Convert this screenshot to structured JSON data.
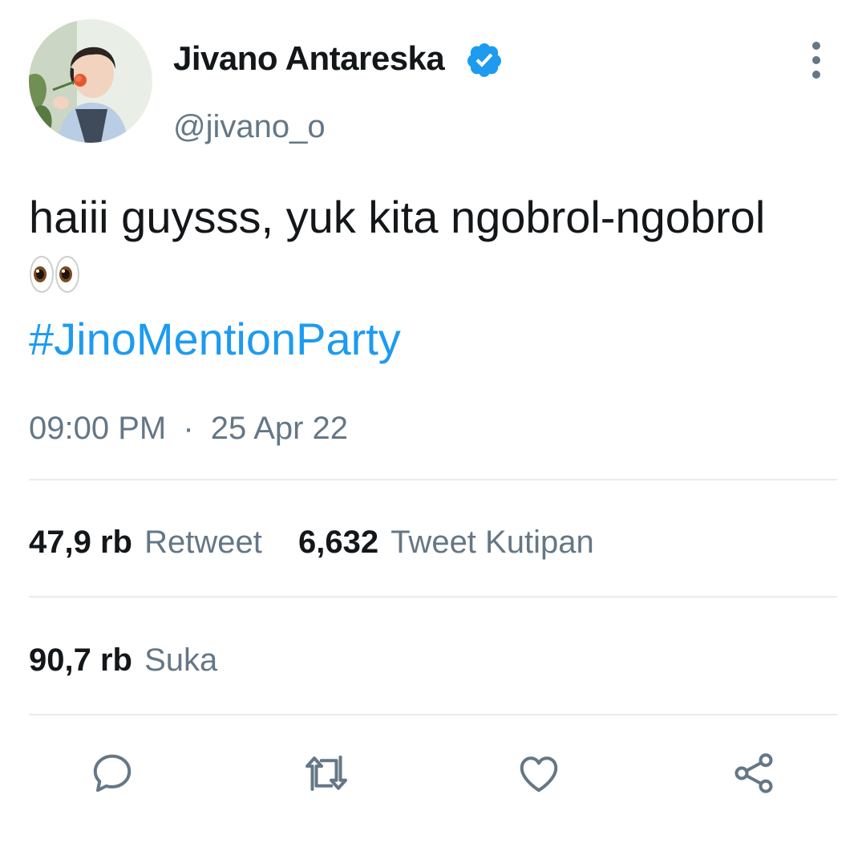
{
  "tweet": {
    "author": {
      "display_name": "Jivano Antareska",
      "handle": "@jivano_o",
      "verified": true,
      "avatar": "profile-photo"
    },
    "text": "haiii guysss, yuk kita ngobrol-ngobrol",
    "emoji": "eyes-emoji",
    "hashtag": "#JinoMentionParty",
    "time": "09:00 PM",
    "separator": "·",
    "date": "25 Apr 22"
  },
  "stats": {
    "retweets": {
      "value": "47,9 rb",
      "label": "Retweet"
    },
    "quote_tweets": {
      "value": "6,632",
      "label": "Tweet Kutipan"
    },
    "likes": {
      "value": "90,7 rb",
      "label": "Suka"
    }
  },
  "actions": [
    {
      "name": "reply",
      "icon": "reply-icon"
    },
    {
      "name": "retweet",
      "icon": "retweet-icon"
    },
    {
      "name": "like",
      "icon": "heart-icon"
    },
    {
      "name": "share",
      "icon": "share-icon"
    }
  ],
  "colors": {
    "text": "#14171a",
    "secondary": "#657786",
    "accent": "#1d9bf0",
    "divider": "#e6ecf0"
  }
}
